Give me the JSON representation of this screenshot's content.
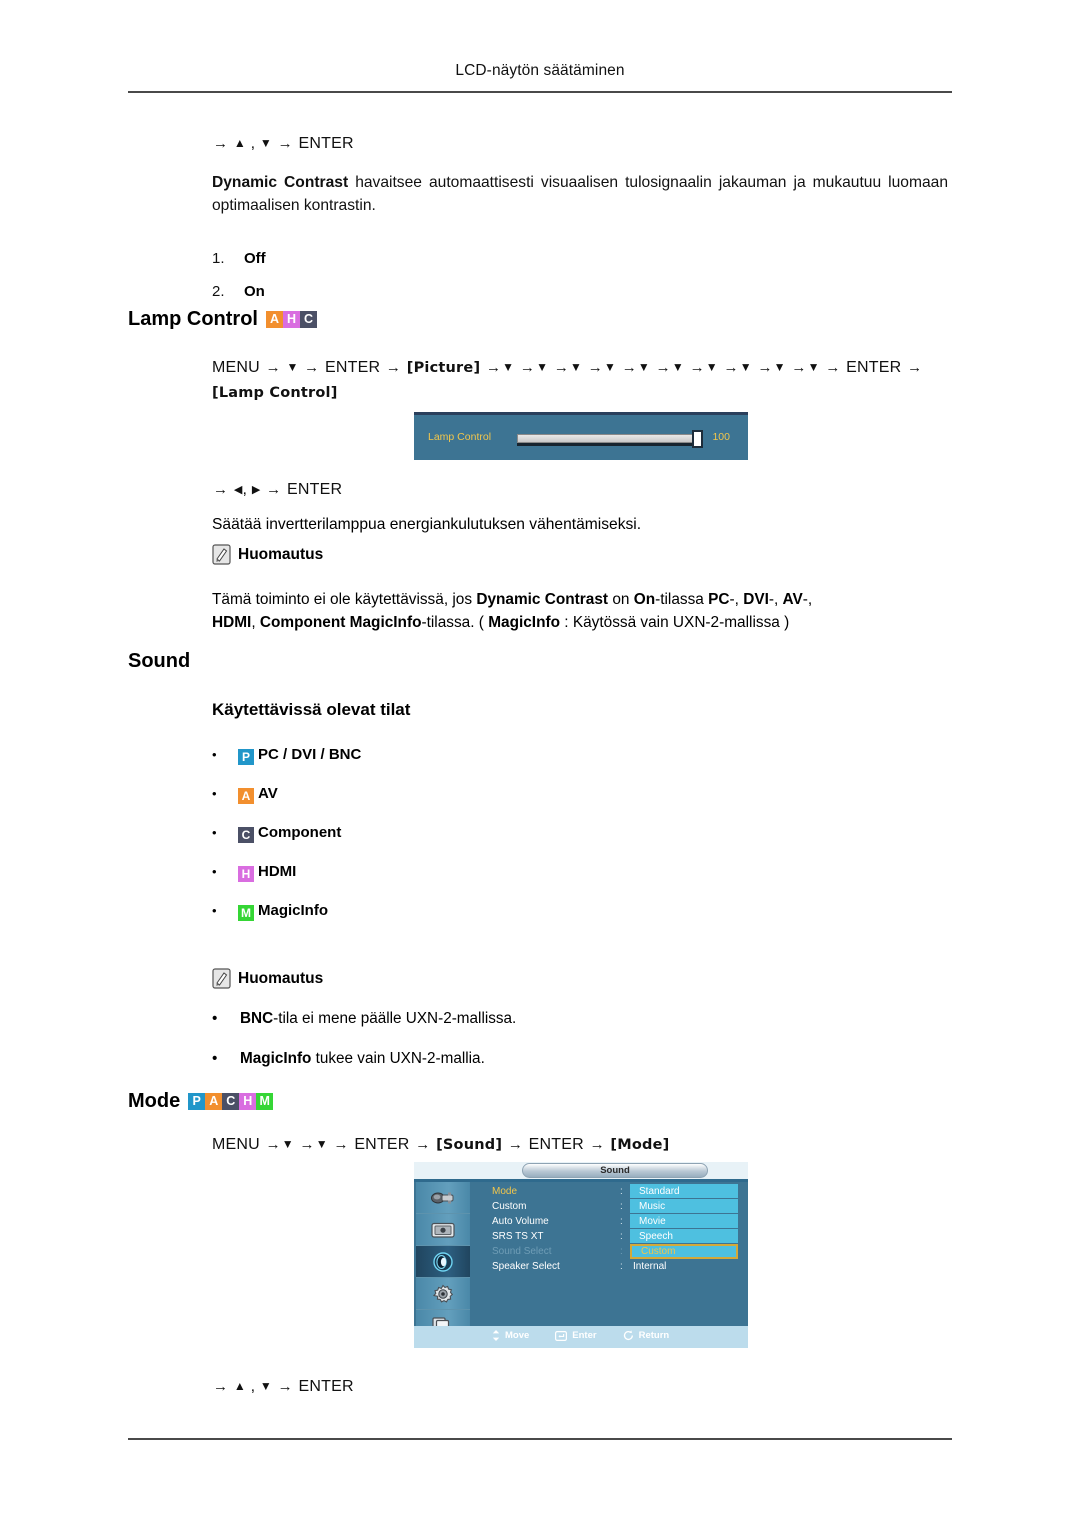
{
  "header": {
    "running_title": "LCD-näytön säätäminen"
  },
  "dynamic_contrast": {
    "nav_prefix": "→",
    "nav_enter": "ENTER",
    "description_bold": "Dynamic Contrast",
    "description_rest": " havaitsee automaattisesti visuaalisen tulosignaalin jakauman ja mukautuu luomaan optimaalisen kontrastin.",
    "options": [
      {
        "num": "1.",
        "label": "Off"
      },
      {
        "num": "2.",
        "label": "On"
      }
    ]
  },
  "lamp_control": {
    "heading": "Lamp Control",
    "badges": [
      {
        "letter": "A",
        "color": "#f28f2e"
      },
      {
        "letter": "H",
        "color": "#d96de0"
      },
      {
        "letter": "C",
        "color": "#4b5066"
      }
    ],
    "nav_menu": "MENU",
    "nav_enter": "ENTER",
    "nav_picture": "[Picture]",
    "nav_lamp": "[Lamp Control]",
    "nav_down_count": 10,
    "osd": {
      "label": "Lamp Control",
      "value": "100",
      "slider_percent": 100,
      "panel_color": "#3d7493",
      "text_color": "#f2c64b"
    },
    "nav_after": "ENTER",
    "description": "Säätää invertterilamppua energiankulutuksen vähentämiseksi.",
    "note_label": "Huomautus",
    "note_line1_parts": [
      {
        "t": "Tämä toiminto ei ole käytettävissä, jos ",
        "b": false
      },
      {
        "t": "Dynamic Contrast",
        "b": true
      },
      {
        "t": " on ",
        "b": false
      },
      {
        "t": "On",
        "b": true
      },
      {
        "t": "-tilassa ",
        "b": false
      },
      {
        "t": "PC",
        "b": true
      },
      {
        "t": "-, ",
        "b": false
      },
      {
        "t": "DVI",
        "b": true
      },
      {
        "t": "-, ",
        "b": false
      },
      {
        "t": "AV",
        "b": true
      },
      {
        "t": "-,",
        "b": false
      }
    ],
    "note_line2_parts": [
      {
        "t": "HDMI",
        "b": true
      },
      {
        "t": ", ",
        "b": false
      },
      {
        "t": "Component MagicInfo",
        "b": true
      },
      {
        "t": "-tilassa. ( ",
        "b": false
      },
      {
        "t": "MagicInfo",
        "b": true
      },
      {
        "t": " : Käytössä vain UXN-2-mallissa )",
        "b": false
      }
    ]
  },
  "sound": {
    "heading": "Sound",
    "sub_heading": "Käytettävissä olevat tilat",
    "modes": [
      {
        "badge": "P",
        "color": "#2196c9",
        "label": "PC / DVI / BNC"
      },
      {
        "badge": "A",
        "color": "#f28f2e",
        "label": "AV"
      },
      {
        "badge": "C",
        "color": "#4b5066",
        "label": "Component"
      },
      {
        "badge": "H",
        "color": "#d96de0",
        "label": "HDMI"
      },
      {
        "badge": "M",
        "color": "#35d635",
        "label": "MagicInfo"
      }
    ],
    "note_label": "Huomautus",
    "notes": [
      [
        {
          "t": "BNC",
          "b": true
        },
        {
          "t": "-tila ei mene päälle UXN-2-mallissa.",
          "b": false
        }
      ],
      [
        {
          "t": "MagicInfo",
          "b": true
        },
        {
          "t": " tukee vain UXN-2-mallia.",
          "b": false
        }
      ]
    ]
  },
  "mode": {
    "heading": "Mode",
    "badges": [
      {
        "letter": "P",
        "color": "#2196c9"
      },
      {
        "letter": "A",
        "color": "#f28f2e"
      },
      {
        "letter": "C",
        "color": "#4b5066"
      },
      {
        "letter": "H",
        "color": "#d96de0"
      },
      {
        "letter": "M",
        "color": "#35d635"
      }
    ],
    "nav_menu": "MENU",
    "nav_enter": "ENTER",
    "nav_sound": "[Sound]",
    "nav_mode": "[Mode]",
    "nav_after": "ENTER",
    "osd": {
      "title": "Sound",
      "sidebar_icons": [
        "input-source-icon",
        "picture-icon",
        "sound-icon",
        "setup-gear-icon",
        "multi-control-icon"
      ],
      "selected_sidebar_index": 2,
      "rows": [
        {
          "label": "Mode",
          "colon": ":",
          "value": "",
          "state": "active"
        },
        {
          "label": "Custom",
          "colon": ":",
          "value": "",
          "state": "normal"
        },
        {
          "label": "Auto Volume",
          "colon": ":",
          "value": "",
          "state": "normal"
        },
        {
          "label": "SRS TS XT",
          "colon": ":",
          "value": "",
          "state": "normal"
        },
        {
          "label": "Sound Select",
          "colon": ":",
          "value": "",
          "state": "disabled"
        },
        {
          "label": "Speaker Select",
          "colon": ":",
          "value": "Internal",
          "state": "normal"
        }
      ],
      "dropdown": {
        "options": [
          "Standard",
          "Music",
          "Movie",
          "Speech",
          "Custom"
        ],
        "selected": "Custom",
        "option_bg": "#4ec0e0",
        "selected_border": "#d4a939"
      },
      "footer": [
        {
          "icon": "move-icon",
          "label": "Move"
        },
        {
          "icon": "enter-icon",
          "label": "Enter"
        },
        {
          "icon": "return-icon",
          "label": "Return"
        }
      ],
      "panel_color": "#3d7493"
    }
  }
}
